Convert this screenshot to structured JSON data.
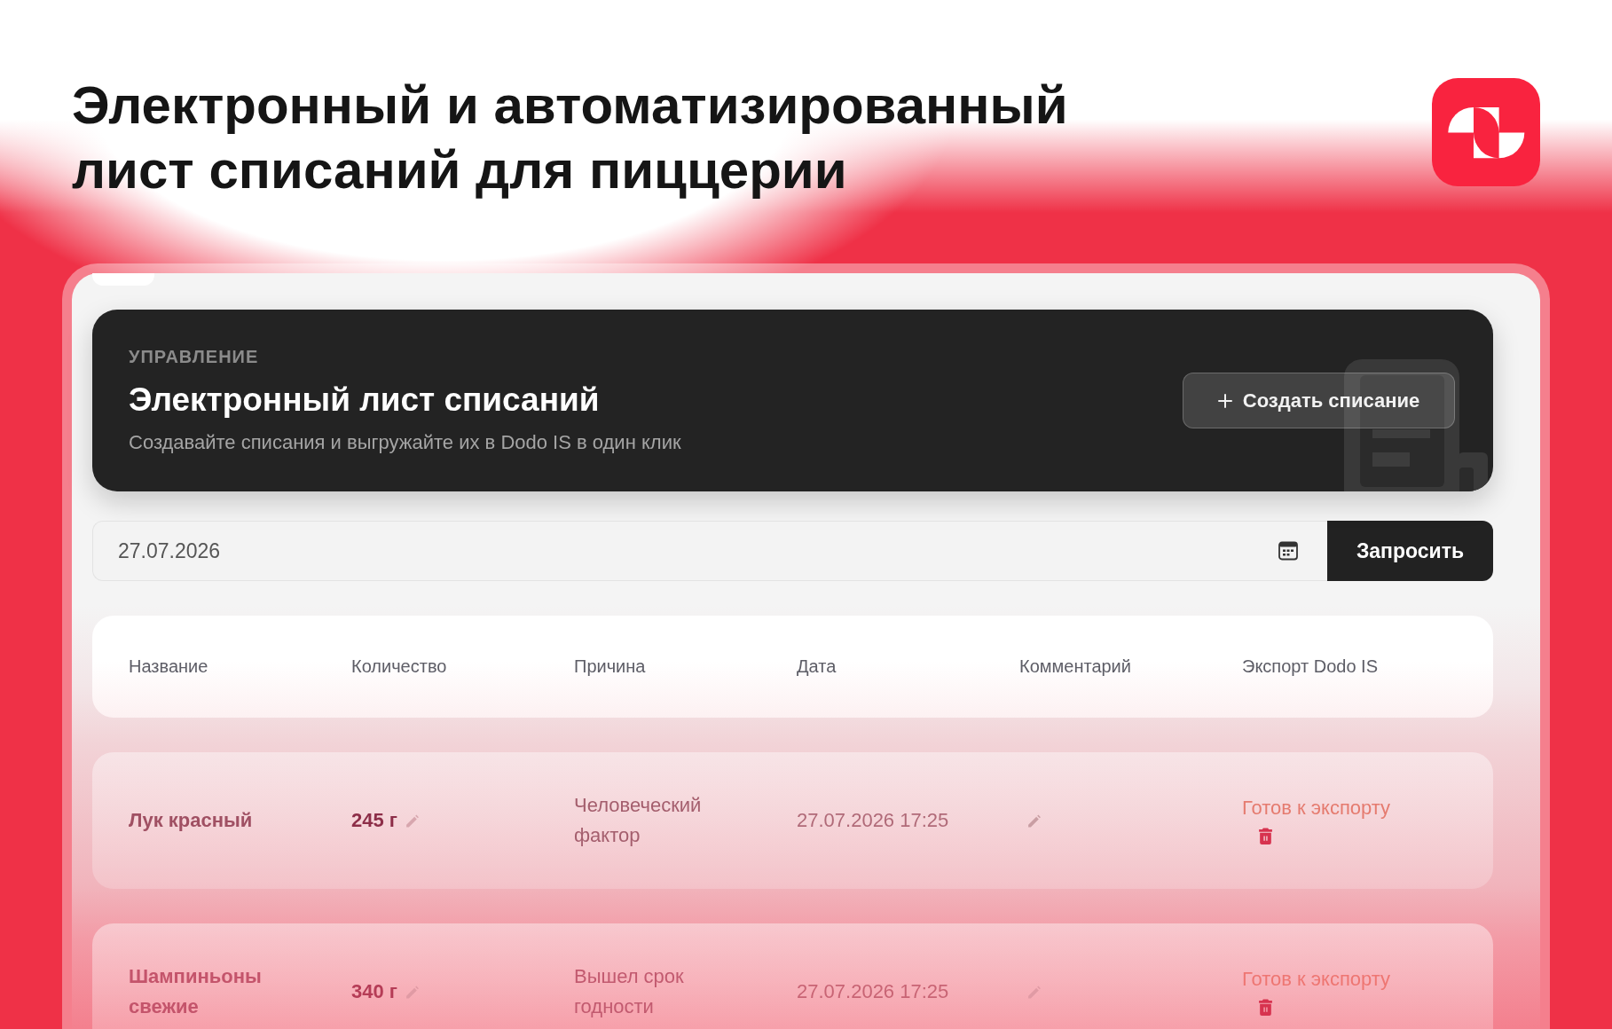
{
  "headline": "Электронный и автоматизированный лист списаний для пиццерии",
  "header": {
    "eyebrow": "УПРАВЛЕНИЕ",
    "title": "Электронный лист списаний",
    "subtitle": "Создавайте списания и выгружайте их в Dodo IS в один клик",
    "create_button": "Создать списание"
  },
  "date_filter": {
    "value": "27.07.2026",
    "button": "Запросить"
  },
  "table": {
    "columns": [
      "Название",
      "Количество",
      "Причина",
      "Дата",
      "Комментарий",
      "Экспорт Dodo IS"
    ],
    "rows": [
      {
        "name": "Лук красный",
        "quantity": "245 г",
        "reason": "Человеческий фактор",
        "date": "27.07.2026 17:25",
        "status": "Готов к экспорту"
      },
      {
        "name": "Шампиньоны свежие",
        "quantity": "340 г",
        "reason": "Вышел срок годности",
        "date": "27.07.2026 17:25",
        "status": "Готов к экспорту"
      }
    ]
  }
}
